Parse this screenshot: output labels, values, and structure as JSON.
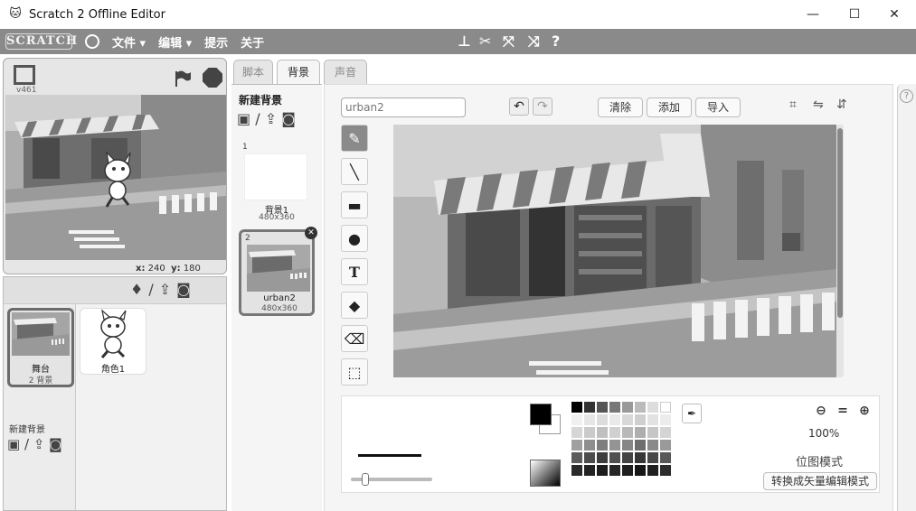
{
  "window": {
    "title": "Scratch 2 Offline Editor",
    "minimize": "—",
    "maximize": "☐",
    "close": "✕"
  },
  "menu": {
    "logo": "SCRATCH",
    "file": "文件 ▾",
    "edit": "编辑 ▾",
    "tips": "提示",
    "about": "关于"
  },
  "stage": {
    "version": "v461",
    "x_label": "x:",
    "x_value": "240",
    "y_label": "y:",
    "y_value": "180"
  },
  "sprites": {
    "stage_name": "舞台",
    "stage_count": "2 背景",
    "new_backdrop_label": "新建背景",
    "items": [
      {
        "name": "角色1"
      }
    ]
  },
  "tabs": {
    "scripts": "脚本",
    "backdrops": "背景",
    "sounds": "声音"
  },
  "costumes": {
    "header": "新建背景",
    "items": [
      {
        "num": "1",
        "name": "背景1",
        "size": "480x360"
      },
      {
        "num": "2",
        "name": "urban2",
        "size": "480x360"
      }
    ]
  },
  "editor": {
    "name_value": "urban2",
    "clear": "清除",
    "add": "添加",
    "import": "导入",
    "zoom": "100%",
    "mode": "位图模式",
    "convert": "转换成矢量编辑模式"
  }
}
